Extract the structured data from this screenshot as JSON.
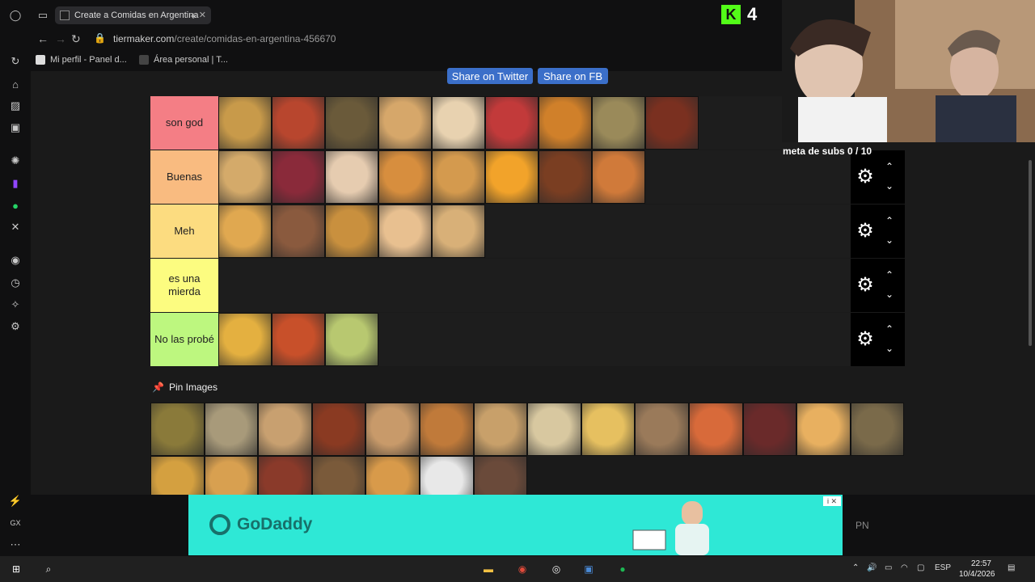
{
  "browser": {
    "tab_title": "Create a Comidas en Argentina",
    "tab_close": "✕",
    "new_tab": "+",
    "url_host": "tiermaker.com",
    "url_path": "/create/comidas-en-argentina-456670",
    "back": "←",
    "forward": "→",
    "reload": "↻",
    "bookmarks": [
      "Mi perfil - Panel d...",
      "Área personal | T..."
    ]
  },
  "share": {
    "twitter": "Share on Twitter",
    "facebook": "Share on FB"
  },
  "tiers": [
    {
      "label": "son god",
      "color": "#f47e85",
      "items": [
        "#c89a4a",
        "#b8462e",
        "#6a5a3a",
        "#d6a76a",
        "#e8d2b0",
        "#c23a3a",
        "#d0802a",
        "#9a8a5a",
        "#7a3020"
      ]
    },
    {
      "label": "Buenas",
      "color": "#f9bb80",
      "items": [
        "#d4aa6a",
        "#8a2a3a",
        "#e6ccb0",
        "#d78e3e",
        "#d49a4e",
        "#f2a32a",
        "#7a3e22",
        "#d07a3a"
      ]
    },
    {
      "label": "Meh",
      "color": "#fcdc80",
      "items": [
        "#e0a850",
        "#8a5a3e",
        "#c9903e",
        "#e8c090",
        "#d8b078"
      ]
    },
    {
      "label": "es una mierda",
      "color": "#fcfc80",
      "items": []
    },
    {
      "label": "No las probé",
      "color": "#bdf77f",
      "items": [
        "#e4b040",
        "#c8502a",
        "#b8c870"
      ]
    }
  ],
  "tier_controls": {
    "gear": "⚙",
    "up": "⌃",
    "down": "⌄"
  },
  "pin": {
    "icon": "📌",
    "label": "Pin Images"
  },
  "pool_items": [
    "#8a7a3a",
    "#a89a7a",
    "#c8a070",
    "#8a3a22",
    "#c89a6a",
    "#c07a3a",
    "#c8a06a",
    "#d8c8a0",
    "#e6c060",
    "#9a7a5a",
    "#d86a3a",
    "#6a2a2a",
    "#e8b060",
    "#7a6a4a",
    "#d4a040",
    "#d8a050",
    "#8a3a2a",
    "#7a5a3a",
    "#d89a4a",
    "#e8e8e8",
    "#6a4a3a"
  ],
  "overlay": {
    "kick_letter": "K",
    "kick_count": "4",
    "subs_goal": "meta de subs 0 / 10"
  },
  "ad": {
    "brand": "GoDaddy",
    "ad_mark": "i ✕"
  },
  "side_text": "PN",
  "taskbar": {
    "lang": "ESP",
    "time": "22:57",
    "date": "10/4/2026"
  }
}
